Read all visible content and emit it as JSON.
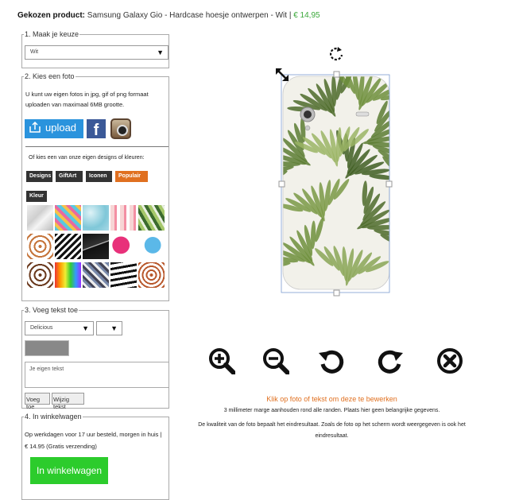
{
  "header": {
    "label": "Gekozen product:",
    "product": "Samsung Galaxy Gio - Hardcase hoesje ontwerpen - Wit",
    "separator": "|",
    "price": "€ 14,95"
  },
  "step1": {
    "legend": "1. Maak je keuze",
    "selected": "Wit"
  },
  "step2": {
    "legend": "2. Kies een foto",
    "intro": "U kunt uw eigen fotos in jpg, gif of png formaat uploaden van maximaal 6MB grootte.",
    "upload_label": "upload",
    "designs_intro": "Of kies een van onze eigen designs of kleuren:",
    "tabs": [
      "Designs",
      "GiftArt",
      "Iconen",
      "Populair",
      "Kleur"
    ]
  },
  "step3": {
    "legend": "3. Voeg tekst toe",
    "font": "Delicious",
    "textarea_placeholder": "Je eigen tekst",
    "add_button": "Voeg toe",
    "edit_button": "Wijzig tekst"
  },
  "step4": {
    "legend": "4. In winkelwagen",
    "delivery": "Op werkdagen voor 17 uur besteld, morgen in huis |",
    "price_line": "€ 14.95 (Gratis verzending)",
    "cart_button": "In winkelwagen"
  },
  "notes": {
    "click_hint": "Klik op foto of tekst om deze te bewerken",
    "margin": "3 millimeter marge aanhouden rond alle randen. Plaats hier geen belangrijke gegevens.",
    "quality": "De kwaliteit van de foto bepaalt het eindresultaat. Zoals de foto op het scherm wordt weergegeven is ook het eindresultaat."
  },
  "colors": {
    "accent": "#e07020",
    "upload": "#2a93dd",
    "cart": "#2ccc2c",
    "price": "#3aa83a"
  },
  "icons": [
    "rotate-icon",
    "resize-icon",
    "zoom-in-icon",
    "zoom-out-icon",
    "rotate-left-icon",
    "rotate-right-icon",
    "delete-icon",
    "upload-icon",
    "facebook-icon",
    "instagram-icon",
    "dropdown-arrow-icon"
  ]
}
